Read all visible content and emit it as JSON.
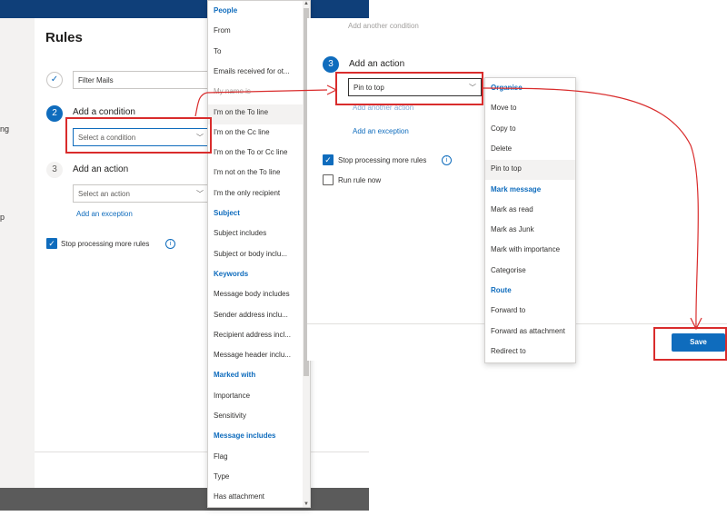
{
  "left": {
    "title": "Rules",
    "rule_name": "Filter Mails",
    "step1_number": "✓",
    "step2_number": "2",
    "step2_label": "Add a condition",
    "condition_placeholder": "Select a condition",
    "step3_number": "3",
    "step3_label": "Add an action",
    "action_placeholder": "Select an action",
    "add_exception": "Add an exception",
    "stop_processing": "Stop processing more rules",
    "cut_text_1": "ng",
    "cut_text_2": "p"
  },
  "condition_dropdown": {
    "groups": [
      {
        "header": "People",
        "items": [
          "From",
          "To",
          "Emails received for ot...",
          "My name is",
          "I'm on the To line",
          "I'm on the Cc line",
          "I'm on the To or Cc line",
          "I'm not on the To line",
          "I'm the only recipient"
        ]
      },
      {
        "header": "Subject",
        "items": [
          "Subject includes",
          "Subject or body inclu..."
        ]
      },
      {
        "header": "Keywords",
        "items": [
          "Message body includes",
          "Sender address inclu...",
          "Recipient address incl...",
          "Message header inclu..."
        ]
      },
      {
        "header": "Marked with",
        "items": [
          "Importance",
          "Sensitivity"
        ]
      },
      {
        "header": "Message includes",
        "items": [
          "Flag",
          "Type",
          "Has attachment"
        ]
      }
    ]
  },
  "right": {
    "step3_number": "3",
    "step3_label": "Add an action",
    "action_value": "Pin to top",
    "add_another_action": "Add another action",
    "add_another_condition": "Add another condition",
    "add_exception": "Add an exception",
    "stop_processing": "Stop processing more rules",
    "run_rule_now": "Run rule now",
    "save": "Save"
  },
  "action_dropdown": {
    "groups": [
      {
        "header": "Organise",
        "items": [
          "Move to",
          "Copy to",
          "Delete",
          "Pin to top"
        ]
      },
      {
        "header": "Mark message",
        "items": [
          "Mark as read",
          "Mark as Junk",
          "Mark with importance",
          "Categorise"
        ]
      },
      {
        "header": "Route",
        "items": [
          "Forward to",
          "Forward as attachment",
          "Redirect to"
        ]
      }
    ],
    "selected": "Pin to top"
  },
  "colors": {
    "accent": "#0f6cbd",
    "annotation": "#d92c2c",
    "topbar": "#0f3f79"
  }
}
